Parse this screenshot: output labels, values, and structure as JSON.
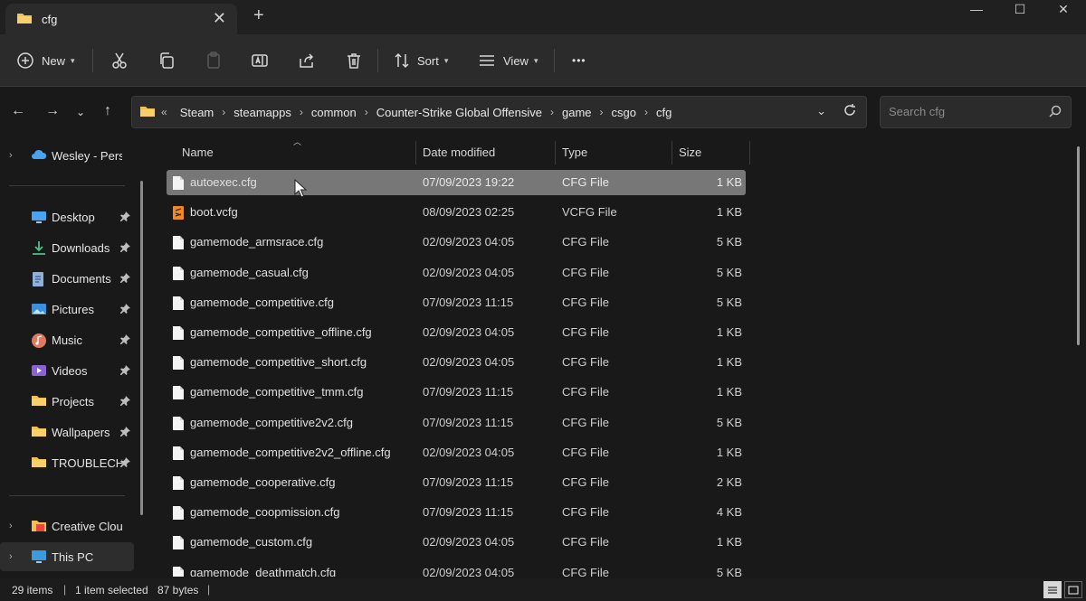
{
  "window": {
    "tab_title": "cfg",
    "new_tab_symbol": "+",
    "close_tab_symbol": "✕",
    "minimize_symbol": "—",
    "maximize_symbol": "☐",
    "close_symbol": "✕"
  },
  "toolbar": {
    "new_label": "New",
    "sort_label": "Sort",
    "view_label": "View",
    "more_label": "•••",
    "icons": [
      "plus-circle-icon",
      "cut-icon",
      "copy-icon",
      "paste-icon",
      "rename-icon",
      "share-icon",
      "delete-icon",
      "sort-icon",
      "view-icon",
      "more-icon"
    ]
  },
  "address": {
    "overflow": "«",
    "breadcrumbs": [
      "Steam",
      "steamapps",
      "common",
      "Counter-Strike Global Offensive",
      "game",
      "csgo",
      "cfg"
    ],
    "search_placeholder": "Search cfg"
  },
  "sidebar": {
    "items": [
      {
        "label": "Wesley - Person",
        "icon": "cloud-icon",
        "pinned": false
      },
      {
        "label": "Desktop",
        "icon": "desktop-icon",
        "pinned": true
      },
      {
        "label": "Downloads",
        "icon": "download-icon",
        "pinned": true
      },
      {
        "label": "Documents",
        "icon": "document-icon",
        "pinned": true
      },
      {
        "label": "Pictures",
        "icon": "picture-icon",
        "pinned": true
      },
      {
        "label": "Music",
        "icon": "music-icon",
        "pinned": true
      },
      {
        "label": "Videos",
        "icon": "video-icon",
        "pinned": true
      },
      {
        "label": "Projects",
        "icon": "folder-icon",
        "pinned": true
      },
      {
        "label": "Wallpapers",
        "icon": "folder-icon",
        "pinned": true
      },
      {
        "label": "TROUBLECHU",
        "icon": "folder-icon",
        "pinned": true
      },
      {
        "label": "Creative Cloud F",
        "icon": "creative-cloud-icon",
        "pinned": false
      },
      {
        "label": "This PC",
        "icon": "pc-icon",
        "pinned": false
      }
    ],
    "pin_glyph": "📌"
  },
  "columns": {
    "name": "Name",
    "date": "Date modified",
    "type": "Type",
    "size": "Size"
  },
  "files": [
    {
      "name": "autoexec.cfg",
      "date": "07/09/2023 19:22",
      "type": "CFG File",
      "size": "1 KB",
      "selected": true,
      "icon": "file-icon"
    },
    {
      "name": "boot.vcfg",
      "date": "08/09/2023 02:25",
      "type": "VCFG File",
      "size": "1 KB",
      "selected": false,
      "icon": "sublime-file-icon"
    },
    {
      "name": "gamemode_armsrace.cfg",
      "date": "02/09/2023 04:05",
      "type": "CFG File",
      "size": "5 KB",
      "selected": false,
      "icon": "file-icon"
    },
    {
      "name": "gamemode_casual.cfg",
      "date": "02/09/2023 04:05",
      "type": "CFG File",
      "size": "5 KB",
      "selected": false,
      "icon": "file-icon"
    },
    {
      "name": "gamemode_competitive.cfg",
      "date": "07/09/2023 11:15",
      "type": "CFG File",
      "size": "5 KB",
      "selected": false,
      "icon": "file-icon"
    },
    {
      "name": "gamemode_competitive_offline.cfg",
      "date": "02/09/2023 04:05",
      "type": "CFG File",
      "size": "1 KB",
      "selected": false,
      "icon": "file-icon"
    },
    {
      "name": "gamemode_competitive_short.cfg",
      "date": "02/09/2023 04:05",
      "type": "CFG File",
      "size": "1 KB",
      "selected": false,
      "icon": "file-icon"
    },
    {
      "name": "gamemode_competitive_tmm.cfg",
      "date": "07/09/2023 11:15",
      "type": "CFG File",
      "size": "1 KB",
      "selected": false,
      "icon": "file-icon"
    },
    {
      "name": "gamemode_competitive2v2.cfg",
      "date": "07/09/2023 11:15",
      "type": "CFG File",
      "size": "5 KB",
      "selected": false,
      "icon": "file-icon"
    },
    {
      "name": "gamemode_competitive2v2_offline.cfg",
      "date": "02/09/2023 04:05",
      "type": "CFG File",
      "size": "1 KB",
      "selected": false,
      "icon": "file-icon"
    },
    {
      "name": "gamemode_cooperative.cfg",
      "date": "07/09/2023 11:15",
      "type": "CFG File",
      "size": "2 KB",
      "selected": false,
      "icon": "file-icon"
    },
    {
      "name": "gamemode_coopmission.cfg",
      "date": "07/09/2023 11:15",
      "type": "CFG File",
      "size": "4 KB",
      "selected": false,
      "icon": "file-icon"
    },
    {
      "name": "gamemode_custom.cfg",
      "date": "02/09/2023 04:05",
      "type": "CFG File",
      "size": "1 KB",
      "selected": false,
      "icon": "file-icon"
    },
    {
      "name": "gamemode_deathmatch.cfg",
      "date": "02/09/2023 04:05",
      "type": "CFG File",
      "size": "5 KB",
      "selected": false,
      "icon": "file-icon"
    }
  ],
  "status": {
    "item_count": "29 items",
    "selection": "1 item selected",
    "size": "87 bytes",
    "separator": "|"
  },
  "colors": {
    "background": "#191919",
    "selected_row": "#777777",
    "folder_yellow": "#f2c14e",
    "accent_blue": "#4aa3f0"
  }
}
